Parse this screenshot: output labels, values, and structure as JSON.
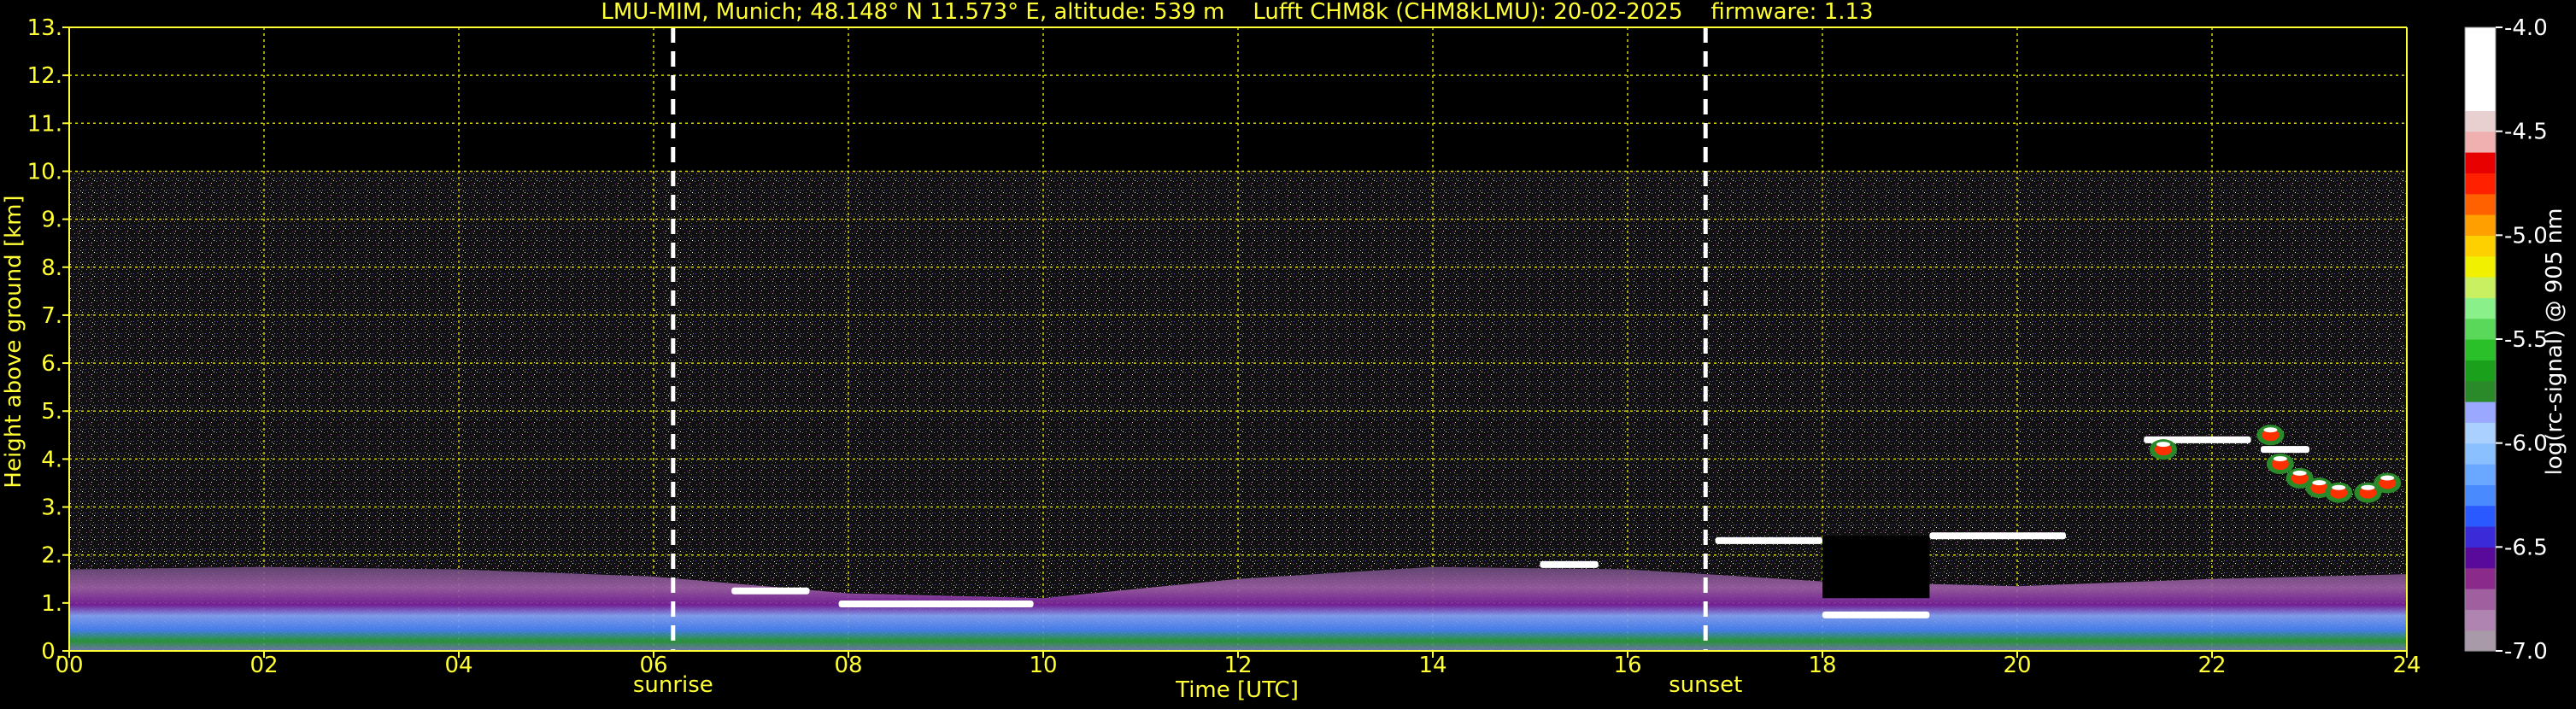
{
  "chart_data": {
    "type": "heatmap",
    "title": "LMU-MIM, Munich; 48.148° N 11.573° E, altitude: 539 m    Lufft CHM8k (CHM8kLMU): 20-02-2025    firmware: 1.13",
    "xlabel": "Time [UTC]",
    "ylabel": "Height above ground [km]",
    "colorbar_label": "log(rc-signal) @ 905 nm",
    "xlim": [
      0,
      24
    ],
    "ylim": [
      0,
      13
    ],
    "x_ticks": [
      "00",
      "02",
      "04",
      "06",
      "08",
      "10",
      "12",
      "14",
      "16",
      "18",
      "20",
      "22",
      "24"
    ],
    "x_tick_values": [
      0,
      2,
      4,
      6,
      8,
      10,
      12,
      14,
      16,
      18,
      20,
      22,
      24
    ],
    "y_ticks": [
      "0.",
      "1.",
      "2.",
      "3.",
      "4.",
      "5.",
      "6.",
      "7.",
      "8.",
      "9.",
      "10.",
      "11.",
      "12.",
      "13."
    ],
    "y_tick_values": [
      0,
      1,
      2,
      3,
      4,
      5,
      6,
      7,
      8,
      9,
      10,
      11,
      12,
      13
    ],
    "colorbar": {
      "range": [
        -7.0,
        -4.0
      ],
      "ticks": [
        "-4.0",
        "-4.5",
        "-5.0",
        "-5.5",
        "-6.0",
        "-6.5",
        "-7.0"
      ],
      "tick_values": [
        -4.0,
        -4.5,
        -5.0,
        -5.5,
        -6.0,
        -6.5,
        -7.0
      ],
      "colors": [
        "#a89aa8",
        "#b084b0",
        "#a060a0",
        "#8a2a8a",
        "#5a0a9a",
        "#3a2ad8",
        "#2a5aff",
        "#4a8aff",
        "#6aa8ff",
        "#8ac0ff",
        "#aad0ff",
        "#9aa8ff",
        "#2a8a2a",
        "#1aa01a",
        "#2ac02a",
        "#5ad85a",
        "#8af08a",
        "#c8f060",
        "#f0f000",
        "#ffd000",
        "#ffa000",
        "#ff6000",
        "#ff2000",
        "#e80000",
        "#f0b0b0",
        "#e8d0d0",
        "#ffffff",
        "#ffffff",
        "#ffffff",
        "#ffffff"
      ]
    },
    "grid": true,
    "signal_top_km": 10,
    "markers": [
      {
        "label": "sunrise",
        "time": 6.2
      },
      {
        "label": "sunset",
        "time": 16.8
      }
    ],
    "boundary_layer": [
      {
        "time": 0,
        "top": 1.7
      },
      {
        "time": 2,
        "top": 1.75
      },
      {
        "time": 4,
        "top": 1.7
      },
      {
        "time": 6,
        "top": 1.55
      },
      {
        "time": 8,
        "top": 1.2
      },
      {
        "time": 10,
        "top": 1.1
      },
      {
        "time": 12,
        "top": 1.5
      },
      {
        "time": 14,
        "top": 1.75
      },
      {
        "time": 16,
        "top": 1.7
      },
      {
        "time": 18,
        "top": 1.45
      },
      {
        "time": 20,
        "top": 1.35
      },
      {
        "time": 22,
        "top": 1.5
      },
      {
        "time": 24,
        "top": 1.6
      }
    ],
    "cloud_layers": [
      {
        "t_start": 7.9,
        "t_end": 9.9,
        "height": 0.98
      },
      {
        "t_start": 6.8,
        "t_end": 7.6,
        "height": 1.25
      },
      {
        "t_start": 15.1,
        "t_end": 15.7,
        "height": 1.8
      },
      {
        "t_start": 16.9,
        "t_end": 18.0,
        "height": 2.3
      },
      {
        "t_start": 18.0,
        "t_end": 19.1,
        "height": 0.75
      },
      {
        "t_start": 19.1,
        "t_end": 20.5,
        "height": 2.4
      },
      {
        "t_start": 21.3,
        "t_end": 22.4,
        "height": 4.4
      },
      {
        "t_start": 22.5,
        "t_end": 23.0,
        "height": 4.2
      }
    ],
    "cloud_patches": [
      {
        "time": 22.7,
        "height": 3.9
      },
      {
        "time": 22.9,
        "height": 3.6
      },
      {
        "time": 23.1,
        "height": 3.4
      },
      {
        "time": 23.3,
        "height": 3.3
      },
      {
        "time": 23.6,
        "height": 3.3
      },
      {
        "time": 22.6,
        "height": 4.5
      },
      {
        "time": 23.8,
        "height": 3.5
      },
      {
        "time": 21.5,
        "height": 4.2
      }
    ],
    "no_signal_regions": [
      {
        "t_start": 18.0,
        "t_end": 19.1,
        "h_start": 1.1,
        "h_end": 2.4
      }
    ]
  }
}
